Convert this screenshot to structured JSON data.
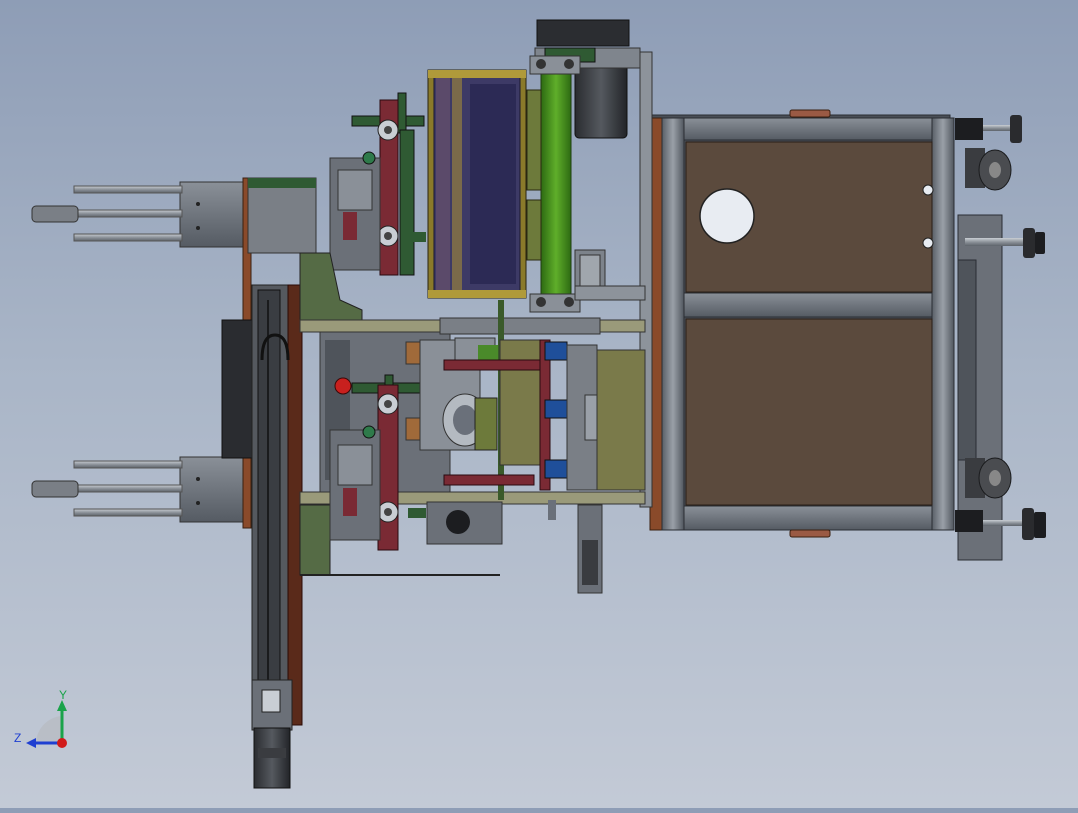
{
  "viewport": {
    "background_top": "#8e9db6",
    "background_bottom": "#c3cad6"
  },
  "triad": {
    "y_label": "Y",
    "z_label": "Z",
    "y_color": "#1aa34a",
    "z_color": "#1f3fd1",
    "x_color": "#d11a1a"
  },
  "colors": {
    "frame_steel": "#6a707a",
    "panel_brown": "#5b4a3d",
    "copper": "#8a4a2a",
    "olive": "#6d7a3b",
    "green_shaft": "#3f8a1e",
    "navy_panel": "#2c2a55",
    "maroon": "#7a2a34",
    "dark_green": "#2f5a33"
  }
}
